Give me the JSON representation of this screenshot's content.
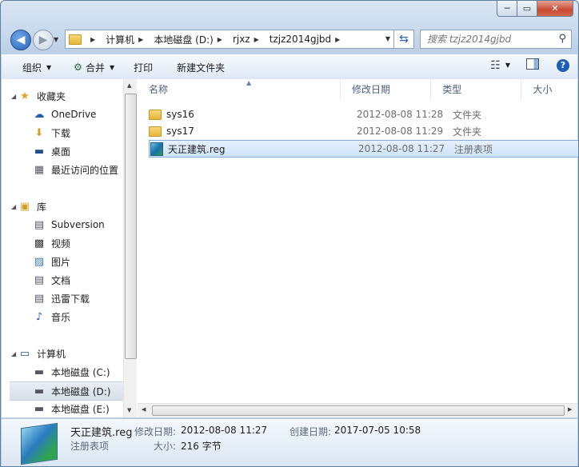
{
  "window": {
    "caption": {
      "minimize": "─",
      "maximize": "▭",
      "close": "✕"
    }
  },
  "address_bar": {
    "crumbs": [
      "计算机",
      "本地磁盘 (D:)",
      "rjxz",
      "tzjz2014gjbd"
    ],
    "search_placeholder": "搜索 tzjz2014gjbd"
  },
  "toolbar": {
    "organize": "组织",
    "combine": "合并",
    "print": "打印",
    "new_folder": "新建文件夹"
  },
  "nav": {
    "favorites": "收藏夹",
    "onedrive": "OneDrive",
    "downloads": "下载",
    "desktop": "桌面",
    "recent": "最近访问的位置",
    "libraries": "库",
    "subversion": "Subversion",
    "videos": "视频",
    "pictures": "图片",
    "documents": "文档",
    "thunder": "迅雷下载",
    "music": "音乐",
    "computer": "计算机",
    "drive_c": "本地磁盘 (C:)",
    "drive_d": "本地磁盘 (D:)",
    "drive_e": "本地磁盘 (E:)"
  },
  "columns": {
    "name": "名称",
    "modified": "修改日期",
    "type": "类型",
    "size": "大小"
  },
  "files": [
    {
      "name": "sys16",
      "modified": "2012-08-08 11:28",
      "type": "文件夹",
      "icon": "folder-icon"
    },
    {
      "name": "sys17",
      "modified": "2012-08-08 11:29",
      "type": "文件夹",
      "icon": "folder-icon"
    },
    {
      "name": "天正建筑.reg",
      "modified": "2012-08-08 11:27",
      "type": "注册表项",
      "icon": "reg-file-icon"
    }
  ],
  "details": {
    "file_name": "天正建筑.reg",
    "file_type": "注册表项",
    "modified_label": "修改日期:",
    "modified_value": "2012-08-08 11:27",
    "created_label": "创建日期:",
    "created_value": "2017-07-05 10:58",
    "size_label": "大小:",
    "size_value": "216 字节"
  }
}
